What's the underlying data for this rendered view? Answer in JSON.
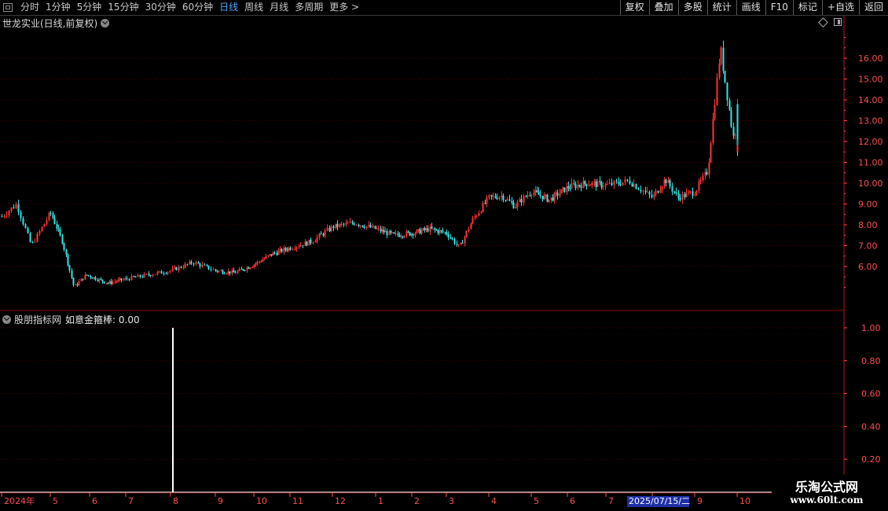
{
  "toolbar": {
    "periods": [
      "分时",
      "1分钟",
      "5分钟",
      "15分钟",
      "30分钟",
      "60分钟",
      "日线",
      "周线",
      "月线",
      "多周期",
      "更多 >"
    ],
    "active_period": "日线",
    "buttons": [
      "复权",
      "叠加",
      "多股",
      "统计",
      "画线",
      "F10",
      "标记",
      "+自选",
      "返回"
    ]
  },
  "main_panel": {
    "title": "世龙实业(日线,前复权)"
  },
  "sub_panel": {
    "source": "股朋指标网",
    "indicator": "如意金箍棒: 0.00"
  },
  "date_axis": {
    "labels": [
      "2024年",
      "5",
      "6",
      "7",
      "8",
      "9",
      "10",
      "11",
      "12",
      "1",
      "2",
      "3",
      "4",
      "5",
      "6",
      "7",
      "8",
      "9",
      "10"
    ],
    "crosshair_date": "2025/07/15/二"
  },
  "watermark": {
    "line1": "乐淘公式网",
    "line2": "www.60lt.com"
  },
  "colors": {
    "up": "#ff3333",
    "down": "#33e6e6",
    "axis": "#ff4d4d",
    "grid": "#5a0000",
    "active_tab": "#4fa7ff"
  },
  "chart_data": [
    {
      "type": "candlestick",
      "title": "世龙实业(日线,前复权)",
      "y_axis_ticks": [
        "16.00",
        "15.00",
        "14.00",
        "13.00",
        "12.00",
        "11.00",
        "10.00",
        "9.00",
        "8.00",
        "7.00",
        "6.00"
      ],
      "ylim": [
        4.5,
        17.5
      ],
      "price_path": [
        {
          "m": 0,
          "p": 8.4
        },
        {
          "m": 0.3,
          "p": 9.0
        },
        {
          "m": 0.6,
          "p": 7.0
        },
        {
          "m": 1.0,
          "p": 8.6
        },
        {
          "m": 1.3,
          "p": 7.2
        },
        {
          "m": 1.6,
          "p": 5.0
        },
        {
          "m": 1.9,
          "p": 5.6
        },
        {
          "m": 2.5,
          "p": 5.2
        },
        {
          "m": 3.0,
          "p": 5.4
        },
        {
          "m": 3.5,
          "p": 5.6
        },
        {
          "m": 4.0,
          "p": 5.8
        },
        {
          "m": 4.5,
          "p": 6.2
        },
        {
          "m": 5.0,
          "p": 5.8
        },
        {
          "m": 5.5,
          "p": 5.7
        },
        {
          "m": 6.0,
          "p": 6.1
        },
        {
          "m": 6.5,
          "p": 6.6
        },
        {
          "m": 7.0,
          "p": 6.9
        },
        {
          "m": 7.5,
          "p": 7.2
        },
        {
          "m": 8.0,
          "p": 7.9
        },
        {
          "m": 8.5,
          "p": 8.1
        },
        {
          "m": 9.0,
          "p": 7.8
        },
        {
          "m": 9.5,
          "p": 7.5
        },
        {
          "m": 10.0,
          "p": 7.6
        },
        {
          "m": 10.5,
          "p": 7.8
        },
        {
          "m": 11.0,
          "p": 7.6
        },
        {
          "m": 11.3,
          "p": 6.9
        },
        {
          "m": 11.6,
          "p": 8.2
        },
        {
          "m": 12.0,
          "p": 9.3
        },
        {
          "m": 12.3,
          "p": 9.4
        },
        {
          "m": 12.6,
          "p": 8.9
        },
        {
          "m": 13.0,
          "p": 9.6
        },
        {
          "m": 13.5,
          "p": 9.2
        },
        {
          "m": 14.0,
          "p": 9.8
        },
        {
          "m": 14.5,
          "p": 10.0
        },
        {
          "m": 15.0,
          "p": 9.9
        },
        {
          "m": 15.5,
          "p": 10.1
        },
        {
          "m": 16.0,
          "p": 9.3
        },
        {
          "m": 16.3,
          "p": 10.2
        },
        {
          "m": 16.6,
          "p": 9.3
        },
        {
          "m": 17.0,
          "p": 9.6
        },
        {
          "m": 17.3,
          "p": 10.6
        },
        {
          "m": 17.6,
          "p": 16.5
        },
        {
          "m": 17.9,
          "p": 12.2
        },
        {
          "m": 18.2,
          "p": 13.8
        },
        {
          "m": 18.5,
          "p": 12.0
        },
        {
          "m": 18.8,
          "p": 11.6
        },
        {
          "m": 19.2,
          "p": 11.7
        }
      ]
    },
    {
      "type": "bar",
      "title": "如意金箍棒",
      "y_axis_ticks": [
        "1.00",
        "0.80",
        "0.60",
        "0.40",
        "0.20"
      ],
      "ylim": [
        0,
        1.0
      ],
      "signals": [
        {
          "date_month_index": 3.2,
          "value": 1.0
        }
      ]
    }
  ]
}
